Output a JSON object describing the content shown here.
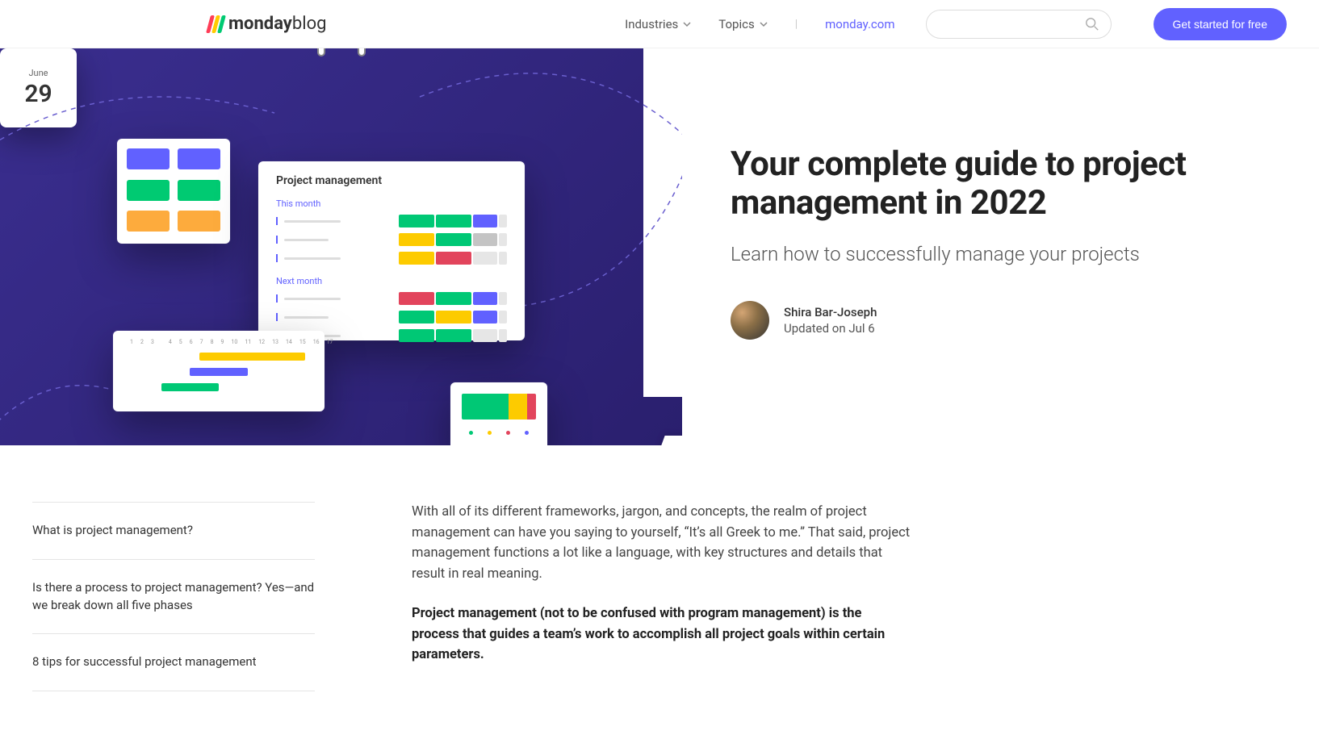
{
  "header": {
    "logo_text_bold": "monday",
    "logo_text_light": "blog",
    "nav": {
      "industries": "Industries",
      "topics": "Topics"
    },
    "brand_link": "monday.com",
    "cta": "Get started for free"
  },
  "hero": {
    "title": "Your complete guide to project management in 2022",
    "subtitle": "Learn how to successfully manage your projects",
    "author": "Shira Bar-Joseph",
    "updated": "Updated on Jul 6",
    "illus": {
      "main_title": "Project management",
      "group1": "This month",
      "group2": "Next month",
      "cal_month": "June",
      "cal_day": "29"
    }
  },
  "toc": {
    "items": [
      "What is project management?",
      "Is there a process to project management? Yes—and we break down all five phases",
      "8 tips for successful project management"
    ]
  },
  "article": {
    "p1": "With all of its different frameworks, jargon, and concepts, the realm of project management can have you saying to yourself, “It’s all Greek to me.” That said, project management functions a lot like a language, with key structures and details that result in real meaning.",
    "p2": "Project management (not to be confused with program management) is the process that guides a team’s work to accomplish all project goals within certain parameters."
  }
}
